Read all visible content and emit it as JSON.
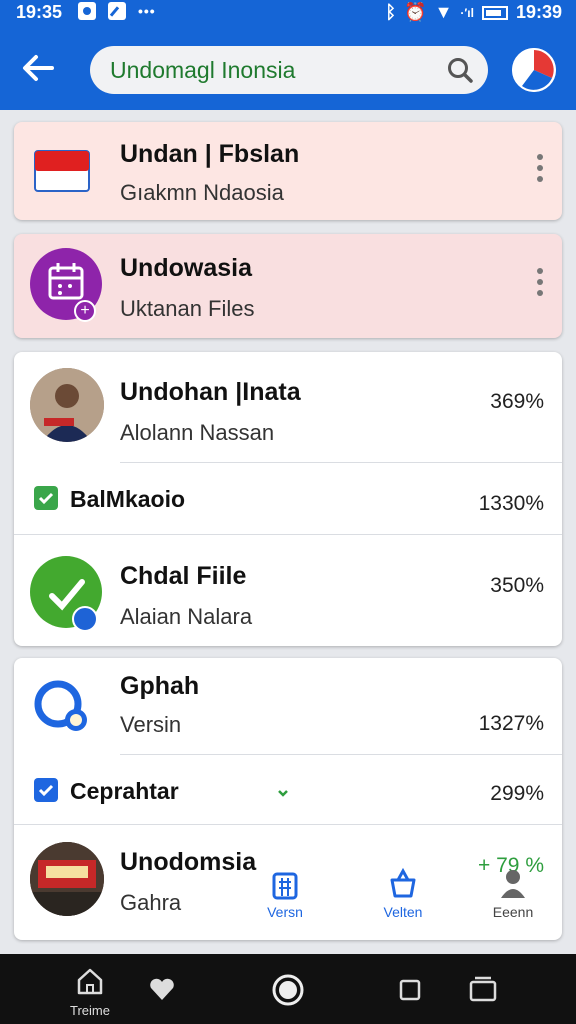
{
  "status": {
    "time_left": "19:35",
    "time_right": "19:39",
    "signal_text": "·′ıl"
  },
  "header": {
    "search_value": "Undomagl Inonsia",
    "back_icon": "arrow-left-icon",
    "search_icon": "search-icon"
  },
  "cards": [
    {
      "title": "Undan | Fbslan",
      "subtitle": "Gıakmn Ndaosia"
    },
    {
      "title": "Undowasia",
      "subtitle": "Uktanan Files"
    }
  ],
  "group1": {
    "rows": [
      {
        "title": "Undohan |Inata",
        "subtitle": "Alolann Nassan",
        "percent": "369%"
      },
      {
        "title": "BalMkaoio",
        "percent": "1330%"
      },
      {
        "title": "Chdal Fiile",
        "subtitle": "Alaian Nalara",
        "percent": "350%"
      }
    ]
  },
  "group2": {
    "rows": [
      {
        "title": "Gphah",
        "subtitle": "Versin",
        "percent": "1327%"
      },
      {
        "title": "Ceprahtar",
        "percent": "299%"
      },
      {
        "title": "Unodomsia",
        "subtitle": "Gahra",
        "percent": "+ 79 %"
      }
    ],
    "inner_nav": [
      {
        "label": "Versn",
        "icon": "building-icon"
      },
      {
        "label": "Velten",
        "icon": "basket-icon"
      },
      {
        "label": "Eeenn",
        "icon": "person-icon"
      }
    ]
  },
  "system_nav": {
    "home_label": "Treime"
  },
  "colors": {
    "app_bar": "#1565d6",
    "accent_green": "#1f7a2e",
    "percent_green": "#2e9e3e"
  }
}
